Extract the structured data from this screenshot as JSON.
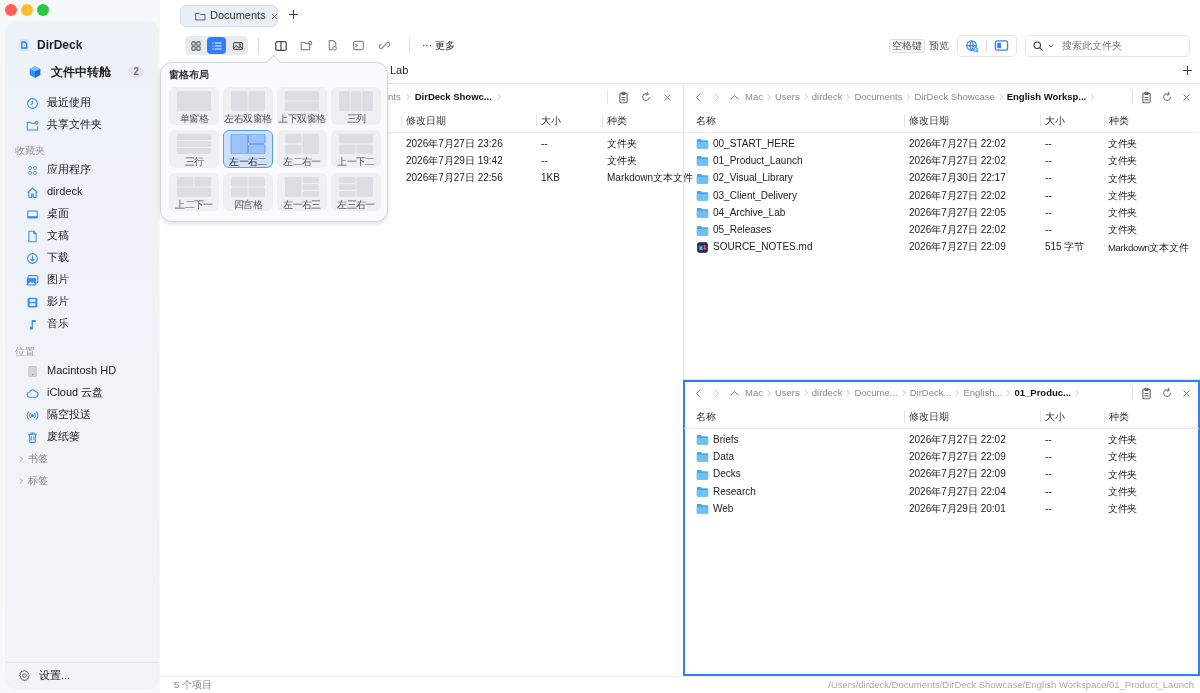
{
  "tabs": [
    {
      "label": "Documents",
      "selected": true
    }
  ],
  "toolbar": {
    "view_modes": [
      {
        "selected": false
      },
      {
        "selected": true
      },
      {
        "selected": false
      }
    ],
    "more": "··· 更多",
    "preview_key": "空格键",
    "preview_label": "预览",
    "search": {
      "placeholder": "搜索此文件夹"
    }
  },
  "sidebar": {
    "app_name": "DirDeck",
    "items": [
      {
        "label": "文件中转舱",
        "badge": "2"
      },
      {
        "label": "最近使用"
      },
      {
        "label": "共享文件夹"
      }
    ],
    "sections": [
      {
        "title": "收藏夹",
        "items": [
          {
            "label": "应用程序"
          },
          {
            "label": "dirdeck"
          },
          {
            "label": "桌面"
          },
          {
            "label": "文稿"
          },
          {
            "label": "下载"
          },
          {
            "label": "图片"
          },
          {
            "label": "影片"
          },
          {
            "label": "音乐"
          }
        ]
      },
      {
        "title": "位置",
        "items": [
          {
            "label": "Macintosh HD"
          },
          {
            "label": "iCloud 云盘"
          },
          {
            "label": "隔空投送"
          },
          {
            "label": "废纸篓"
          }
        ]
      }
    ],
    "groups": [
      {
        "label": "书签",
        "expanded": false
      },
      {
        "label": "标签",
        "expanded": false
      }
    ],
    "settings": "设置..."
  },
  "pane_tabs": [
    {
      "label": "Lab"
    }
  ],
  "panes": [
    {
      "selected": false,
      "breadcrumb": [
        "nts",
        "DirDeck Showc..."
      ],
      "columns": [
        "修改日期",
        "大小",
        "种类"
      ],
      "rows": [
        {
          "modified": "2026年7月27日 23:26",
          "size": "--",
          "type": "文件夹"
        },
        {
          "modified": "2026年7月29日 19:42",
          "size": "--",
          "type": "文件夹"
        },
        {
          "modified": "2026年7月27日 22:56",
          "size": "1KB",
          "type": "Markdown文本文件"
        }
      ]
    },
    {
      "selected": false,
      "nav_buttons": true,
      "breadcrumb": [
        "Mac",
        "Users",
        "dirdeck",
        "Documents",
        "DirDeck Showcase",
        "English Worksp..."
      ],
      "columns": [
        "名称",
        "修改日期",
        "大小",
        "种类"
      ],
      "rows": [
        {
          "kind": "folder",
          "name": "00_START_HERE",
          "modified": "2026年7月27日 22:02",
          "size": "--",
          "type": "文件夹"
        },
        {
          "kind": "folder",
          "name": "01_Product_Launch",
          "modified": "2026年7月27日 22:02",
          "size": "--",
          "type": "文件夹"
        },
        {
          "kind": "folder",
          "name": "02_Visual_Library",
          "modified": "2026年7月30日 22:17",
          "size": "--",
          "type": "文件夹"
        },
        {
          "kind": "folder",
          "name": "03_Client_Delivery",
          "modified": "2026年7月27日 22:02",
          "size": "--",
          "type": "文件夹"
        },
        {
          "kind": "folder",
          "name": "04_Archive_Lab",
          "modified": "2026年7月27日 22:05",
          "size": "--",
          "type": "文件夹"
        },
        {
          "kind": "folder",
          "name": "05_Releases",
          "modified": "2026年7月27日 22:02",
          "size": "--",
          "type": "文件夹"
        },
        {
          "kind": "markdown",
          "name": "SOURCE_NOTES.md",
          "modified": "2026年7月27日 22:09",
          "size": "515 字节",
          "type": "Markdown文本文件"
        }
      ]
    },
    {
      "selected": true,
      "nav_buttons": true,
      "breadcrumb": [
        "Mac",
        "Users",
        "dirdeck",
        "Docume...",
        "DirDeck...",
        "English...",
        "01_Produc..."
      ],
      "columns": [
        "名称",
        "修改日期",
        "大小",
        "种类"
      ],
      "rows": [
        {
          "kind": "folder",
          "name": "Briefs",
          "modified": "2026年7月27日 22:02",
          "size": "--",
          "type": "文件夹"
        },
        {
          "kind": "folder",
          "name": "Data",
          "modified": "2026年7月27日 22:09",
          "size": "--",
          "type": "文件夹"
        },
        {
          "kind": "folder",
          "name": "Decks",
          "modified": "2026年7月27日 22:09",
          "size": "--",
          "type": "文件夹"
        },
        {
          "kind": "folder",
          "name": "Research",
          "modified": "2026年7月27日 22:04",
          "size": "--",
          "type": "文件夹"
        },
        {
          "kind": "folder",
          "name": "Web",
          "modified": "2026年7月29日 20:01",
          "size": "--",
          "type": "文件夹"
        }
      ]
    }
  ],
  "popover": {
    "title": "窗格布局",
    "options": [
      {
        "label": "单窗格",
        "selected": false
      },
      {
        "label": "左右双窗格",
        "selected": false
      },
      {
        "label": "上下双窗格",
        "selected": false
      },
      {
        "label": "三列",
        "selected": false
      },
      {
        "label": "三行",
        "selected": false
      },
      {
        "label": "左一右二",
        "selected": true
      },
      {
        "label": "左二右一",
        "selected": false
      },
      {
        "label": "上一下二",
        "selected": false
      },
      {
        "label": "上二下一",
        "selected": false
      },
      {
        "label": "四宫格",
        "selected": false
      },
      {
        "label": "左一右三",
        "selected": false
      },
      {
        "label": "左三右一",
        "selected": false
      }
    ]
  },
  "status_bar": {
    "count": "5 个项目",
    "path": "/Users/dirdeck/Documents/DirDeck Showcase/English Workspace/01_Product_Launch"
  }
}
